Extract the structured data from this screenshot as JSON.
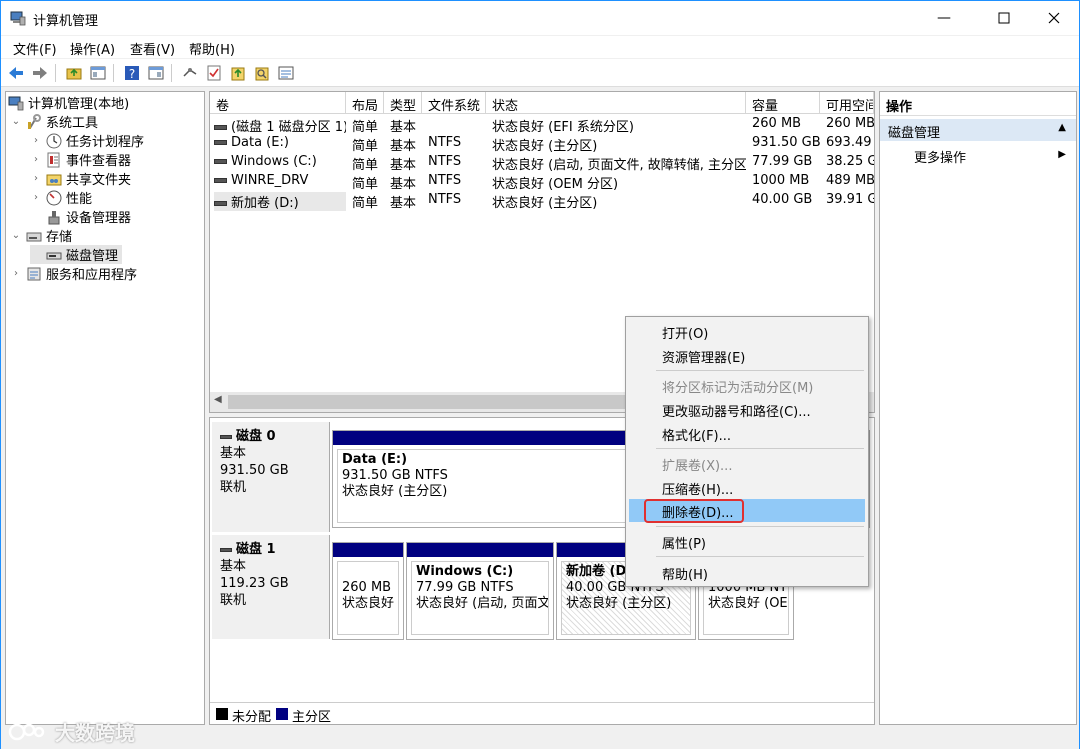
{
  "window": {
    "title": "计算机管理"
  },
  "menu": [
    "文件(F)",
    "操作(A)",
    "查看(V)",
    "帮助(H)"
  ],
  "tree": {
    "root": "计算机管理(本地)",
    "system_tools": "系统工具",
    "task_scheduler": "任务计划程序",
    "event_viewer": "事件查看器",
    "shared_folders": "共享文件夹",
    "performance": "性能",
    "device_manager": "设备管理器",
    "storage": "存储",
    "disk_management": "磁盘管理",
    "services_apps": "服务和应用程序"
  },
  "volume_table": {
    "headers": [
      "卷",
      "布局",
      "类型",
      "文件系统",
      "状态",
      "容量",
      "可用空间"
    ],
    "rows": [
      [
        "(磁盘 1 磁盘分区 1)",
        "简单",
        "基本",
        "",
        "状态良好 (EFI 系统分区)",
        "260 MB",
        "260 MB"
      ],
      [
        "Data (E:)",
        "简单",
        "基本",
        "NTFS",
        "状态良好 (主分区)",
        "931.50 GB",
        "693.49"
      ],
      [
        "Windows (C:)",
        "简单",
        "基本",
        "NTFS",
        "状态良好 (启动, 页面文件, 故障转储, 主分区)",
        "77.99 GB",
        "38.25 G"
      ],
      [
        "WINRE_DRV",
        "简单",
        "基本",
        "NTFS",
        "状态良好 (OEM 分区)",
        "1000 MB",
        "489 MB"
      ],
      [
        "新加卷 (D:)",
        "简单",
        "基本",
        "NTFS",
        "状态良好 (主分区)",
        "40.00 GB",
        "39.91 G"
      ]
    ]
  },
  "disks": {
    "disk0": {
      "name": "磁盘 0",
      "type": "基本",
      "size": "931.50 GB",
      "state": "联机",
      "part1": {
        "name": "Data  (E:)",
        "size": "931.50 GB NTFS",
        "status": "状态良好 (主分区)"
      }
    },
    "disk1": {
      "name": "磁盘 1",
      "type": "基本",
      "size": "119.23 GB",
      "state": "联机",
      "part1": {
        "size": "260 MB",
        "status": "状态良好 ("
      },
      "part2": {
        "name": "Windows  (C:)",
        "size": "77.99 GB NTFS",
        "status": "状态良好 (启动, 页面文("
      },
      "part3": {
        "name": "新加卷  (D:",
        "size": "40.00 GB NTFS",
        "status": "状态良好 (主分区)"
      },
      "part4": {
        "size": "1000 MB NT",
        "status": "状态良好 (OE"
      }
    }
  },
  "legend": {
    "unallocated": "未分配",
    "primary": "主分区"
  },
  "actions": {
    "header": "操作",
    "group": "磁盘管理",
    "more": "更多操作"
  },
  "context_menu": {
    "open": "打开(O)",
    "explorer": "资源管理器(E)",
    "mark_active": "将分区标记为活动分区(M)",
    "change_letter": "更改驱动器号和路径(C)...",
    "format": "格式化(F)...",
    "extend": "扩展卷(X)...",
    "shrink": "压缩卷(H)...",
    "delete": "删除卷(D)...",
    "properties": "属性(P)",
    "help": "帮助(H)"
  },
  "watermark": "大数跨境",
  "colors": {
    "primary_partition": "#000080",
    "highlight": "#91c9f7",
    "red_box": "#e03030"
  }
}
